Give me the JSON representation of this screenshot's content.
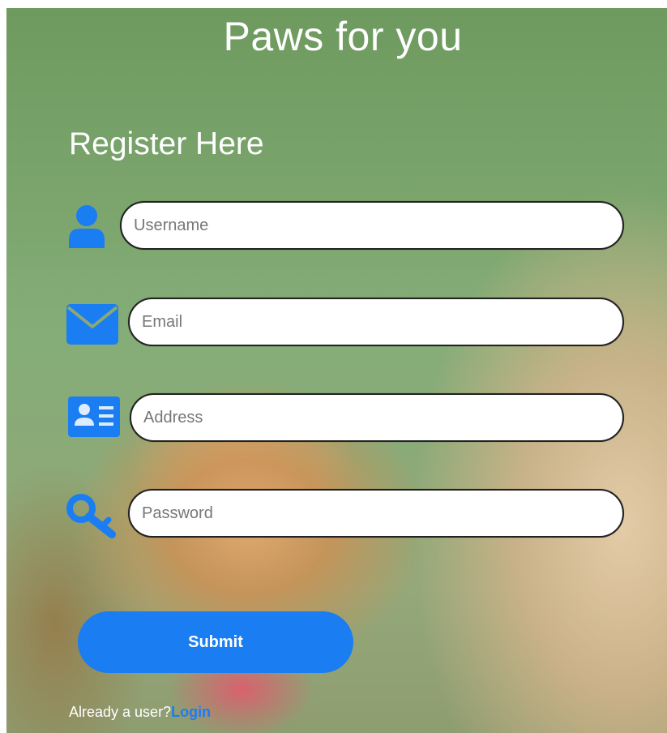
{
  "header": {
    "title": "Paws for you"
  },
  "form": {
    "heading": "Register Here",
    "username": {
      "placeholder": "Username",
      "value": "",
      "icon": "user-icon"
    },
    "email": {
      "placeholder": "Email",
      "value": "",
      "icon": "envelope-icon"
    },
    "address": {
      "placeholder": "Address",
      "value": "",
      "icon": "address-card-icon"
    },
    "password": {
      "placeholder": "Password",
      "value": "",
      "icon": "key-icon"
    },
    "submit_label": "Submit"
  },
  "footer": {
    "prompt": "Already a user?",
    "login_label": "Login"
  },
  "colors": {
    "accent": "#1a7df2",
    "text_light": "#ffffff",
    "field_bg": "#ffffff"
  }
}
